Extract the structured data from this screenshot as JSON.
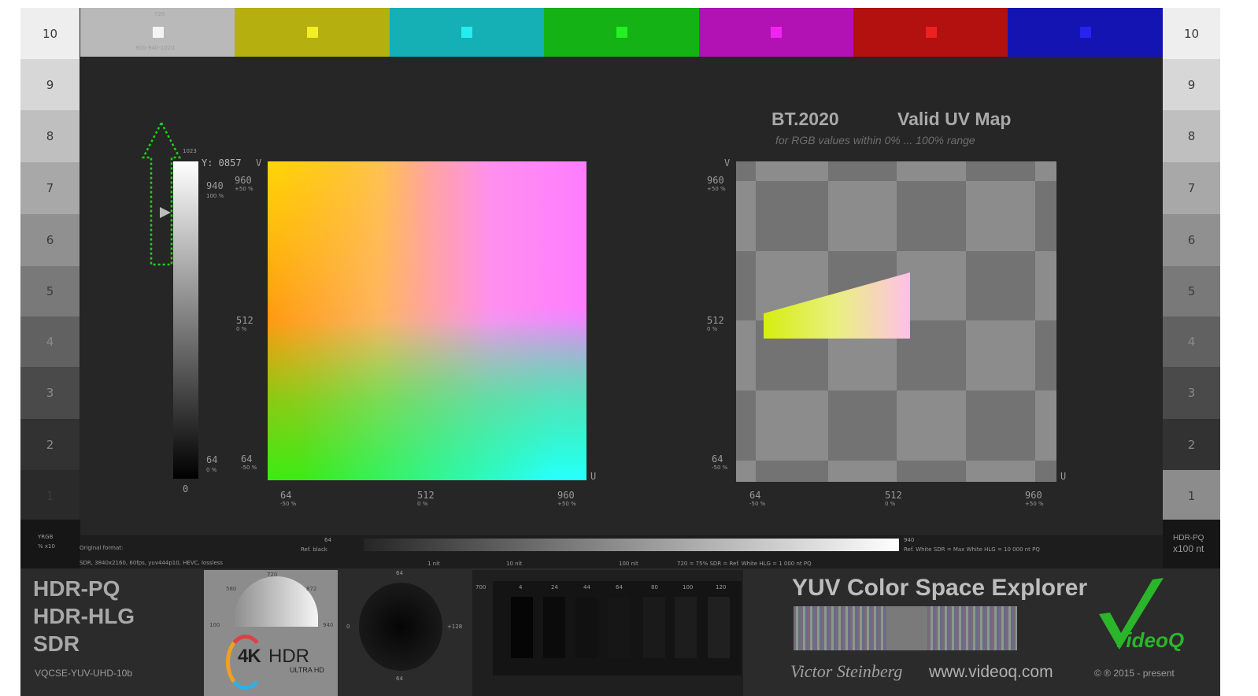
{
  "left_scale": [
    "10",
    "9",
    "8",
    "7",
    "6",
    "5",
    "4",
    "3",
    "2",
    "1"
  ],
  "right_scale": [
    "10",
    "9",
    "8",
    "7",
    "6",
    "5",
    "4",
    "3",
    "2",
    "1"
  ],
  "color_bars": [
    {
      "name": "white",
      "bg": "#b9b9b9",
      "chip": "#f4f4f4"
    },
    {
      "name": "yellow",
      "bg": "#b5af10",
      "chip": "#f2ef25"
    },
    {
      "name": "cyan",
      "bg": "#14b0b6",
      "chip": "#22eef2"
    },
    {
      "name": "green",
      "bg": "#14b214",
      "chip": "#25ef25"
    },
    {
      "name": "magenta",
      "bg": "#b212b4",
      "chip": "#ef25ef"
    },
    {
      "name": "red",
      "bg": "#b31010",
      "chip": "#ef2020"
    },
    {
      "name": "blue",
      "bg": "#1414b2",
      "chip": "#2525ef"
    }
  ],
  "white_bar_top": "720",
  "white_bar_bottom": "800-940-1020",
  "luma": {
    "top_label": "1023",
    "readout": "Y: 0857",
    "hi_label": "940",
    "hi_sub": "100 %",
    "lo_label": "64",
    "lo_sub": "0 %",
    "bottom_label": "0"
  },
  "uv_square": {
    "v_axis": "V",
    "u_axis": "U",
    "y_ticks": [
      {
        "label": "960",
        "sub": "+50 %"
      },
      {
        "label": "512",
        "sub": "0 %"
      },
      {
        "label": "64",
        "sub": "-50 %"
      }
    ],
    "x_ticks": [
      {
        "label": "64",
        "sub": "-50 %"
      },
      {
        "label": "512",
        "sub": "0 %"
      },
      {
        "label": "960",
        "sub": "+50 %"
      }
    ]
  },
  "uv_map": {
    "title_left": "BT.2020",
    "title_right": "Valid UV Map",
    "subtitle": "for RGB values within 0% ... 100% range",
    "v_axis": "V",
    "u_axis": "U",
    "y_ticks": [
      {
        "label": "960",
        "sub": "+50 %"
      },
      {
        "label": "512",
        "sub": "0 %"
      },
      {
        "label": "64",
        "sub": "-50 %"
      }
    ],
    "x_ticks": [
      {
        "label": "64",
        "sub": "-50 %"
      },
      {
        "label": "512",
        "sub": "0 %"
      },
      {
        "label": "960",
        "sub": "+50 %"
      }
    ]
  },
  "strip": {
    "left_top": "YRGB",
    "left_bottom": "% x10",
    "format_line1": "Original format:",
    "format_line2": "SDR, 3840x2160, 60fps, yuv444p10, HEVC, lossless",
    "ref_black_top": "64",
    "ref_black": "Ref. black",
    "tick_1nit": "1 nit",
    "tick_10nit": "10 nit",
    "tick_100nit": "100 nit",
    "mid_note": "720 = 75% SDR = Ref. White HLG = 1 000 nt PQ",
    "ref_white_top": "940",
    "ref_white": "Ref. White SDR = Max White HLG = 10 000 nt PQ",
    "right_top": "HDR-PQ",
    "right_bottom": "x100 nt"
  },
  "formats": [
    "HDR-PQ",
    "HDR-HLG",
    "SDR"
  ],
  "code": "VQCSE-YUV-UHD-10b",
  "gauge": {
    "top": "720",
    "left": "580",
    "right": "872",
    "far_left": "100",
    "far_right": "940",
    "logo_4k": "4K",
    "logo_hdr": "HDR",
    "logo_ultra": "ULTRA HD"
  },
  "wheel": {
    "top": "64",
    "left": "0",
    "right": "+128",
    "bottom": "64"
  },
  "near_black": {
    "left_label": "700",
    "ticks": [
      "4",
      "24",
      "44",
      "64",
      "80",
      "100",
      "120"
    ]
  },
  "brand": {
    "title": "YUV Color Space Explorer",
    "signature": "Victor Steinberg",
    "website": "www.videoq.com",
    "copyright": "© ® 2015 - present",
    "logo_text": "VideoQ"
  },
  "colors": {
    "background": "#232323",
    "panel_dark": "#2b2b2b",
    "checker_light": "#8c8c8c",
    "checker_dark": "#737373",
    "arrow": "#1bd21b"
  }
}
